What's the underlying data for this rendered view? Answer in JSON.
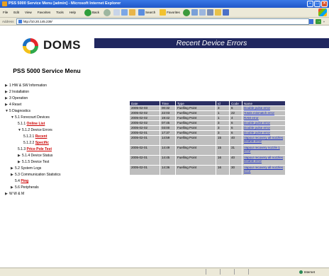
{
  "window": {
    "title": "PSS 5000 Service Menu [admin] - Microsoft Internet Explorer"
  },
  "menubar": [
    "File",
    "Edit",
    "View",
    "Favorites",
    "Tools",
    "Help"
  ],
  "toolbar": {
    "back": "Back",
    "search": "Search",
    "favorites": "Favorites"
  },
  "address": {
    "label": "Address",
    "url": "http://10.20.145.239/"
  },
  "sidebar": {
    "logo_text": "DOMS",
    "title": "PSS 5000 Service Menu",
    "items": [
      {
        "label": "1 HW & SW Information"
      },
      {
        "label": "2 Installation"
      },
      {
        "label": "3 Operation"
      },
      {
        "label": "4 Reset"
      },
      {
        "label": "5 Diagnostics"
      },
      {
        "label": "5.1 Forecourt Devices"
      },
      {
        "prefix": "5.1.1",
        "label": "Online List"
      },
      {
        "label": "5.1.2 Device Errors"
      },
      {
        "prefix": "5.1.2.1",
        "label": "Recent"
      },
      {
        "prefix": "5.1.2.2",
        "label": "Specific"
      },
      {
        "prefix": "5.1.3",
        "label": "Price Pole Test"
      },
      {
        "label": "5.1.4 Device Status"
      },
      {
        "label": "5.1.5 Device Test"
      },
      {
        "label": "5.2 System Logs"
      },
      {
        "label": "5.3 Communication Statistics"
      },
      {
        "prefix": "5.4",
        "label": "Ping"
      },
      {
        "label": "5.6 Peripherals"
      },
      {
        "label": "W W & M"
      }
    ]
  },
  "main": {
    "header": "Recent Device Errors",
    "table": {
      "columns": [
        "Date",
        "Time",
        "Type",
        "Id",
        "Code",
        "Name"
      ],
      "rows": [
        [
          "2005-02-03",
          "00:32",
          "Fuelling Point",
          "3",
          "6",
          "Double pulse error"
        ],
        [
          "2005-02-02",
          "22:03",
          "Fuelling Point",
          "1",
          "22",
          "Totals mismatch error"
        ],
        [
          "2005-02-02",
          "19:42",
          "Fuelling Point",
          "1",
          "4",
          "RAM error"
        ],
        [
          "2005-02-02",
          "07:45",
          "Fuelling Point",
          "3",
          "6",
          "Double pulse error"
        ],
        [
          "2005-02-02",
          "03:00",
          "Fuelling Point",
          "3",
          "6",
          "Double pulse error"
        ],
        [
          "2005-02-01",
          "17:37",
          "Fuelling Point",
          "3",
          "6",
          "Double pulse error"
        ],
        [
          "2005-02-01",
          "14:59",
          "Fuelling Point",
          "15",
          "40",
          "Vapour recovery all nozzles disable error"
        ],
        [
          "2005-02-01",
          "14:49",
          "Fuelling Point",
          "15",
          "31",
          "Vapour recovery nozzle 1 error"
        ],
        [
          "2005-02-01",
          "14:45",
          "Fuelling Point",
          "16",
          "40",
          "Vapour recovery all nozzles disable error"
        ],
        [
          "2005-02-01",
          "14:36",
          "Fuelling Point",
          "16",
          "30",
          "Vapour recovery all nozzles error"
        ]
      ]
    }
  },
  "status": {
    "zone": "Internet"
  }
}
